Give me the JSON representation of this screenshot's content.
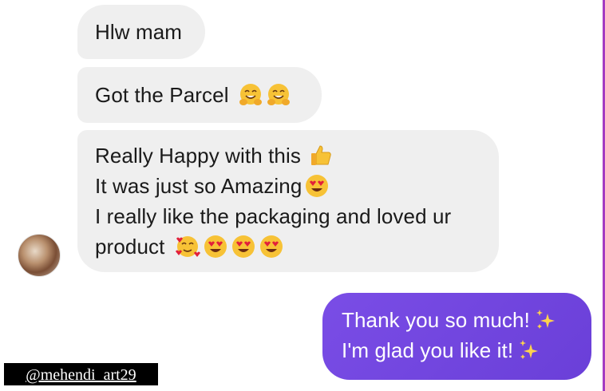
{
  "conversation": {
    "incoming": [
      {
        "lines": [
          {
            "text": "Hlw mam",
            "emojis": []
          }
        ]
      },
      {
        "lines": [
          {
            "text": "Got the Parcel",
            "emojis": [
              "hugging-face-emoji",
              "hugging-face-emoji"
            ]
          }
        ]
      },
      {
        "lines": [
          {
            "text": "Really Happy with this",
            "emojis": [
              "thumbs-up-emoji"
            ]
          },
          {
            "text": "It was just so Amazing",
            "emojis": [
              "heart-eyes-emoji"
            ]
          },
          {
            "text": "I really like the packaging and loved ur",
            "emojis": []
          },
          {
            "text": "product",
            "emojis": [
              "smiling-hearts-emoji",
              "heart-eyes-emoji",
              "heart-eyes-emoji",
              "heart-eyes-emoji"
            ]
          }
        ]
      }
    ],
    "outgoing": {
      "lines": [
        {
          "text": "Thank you so much!",
          "emojis": [
            "sparkles-emoji"
          ]
        },
        {
          "text": "I'm glad you like it!",
          "emojis": [
            "sparkles-emoji"
          ]
        }
      ]
    }
  },
  "watermark": "@mehendi_art29",
  "colors": {
    "incoming_bubble": "#efefef",
    "outgoing_bubble": "#7048e0",
    "right_edge": "#a43cc2",
    "emoji_yellow": "#f7c236"
  }
}
